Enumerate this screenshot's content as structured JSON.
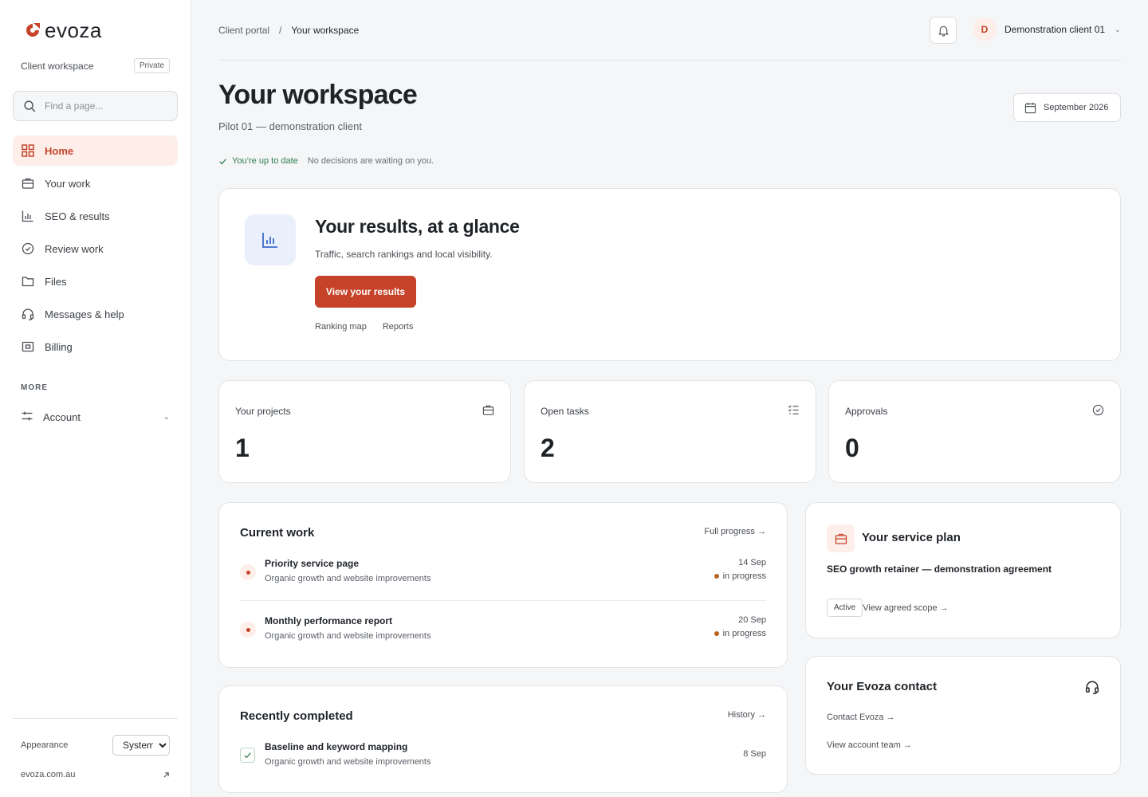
{
  "brand": {
    "name": "evoza",
    "accent": "#c6432a"
  },
  "sidebar": {
    "workspace_label": "Client workspace",
    "workspace_badge": "Private",
    "search_placeholder": "Find a page...",
    "nav": [
      {
        "label": "Home",
        "icon": "grid-icon",
        "active": true
      },
      {
        "label": "Your work",
        "icon": "briefcase-icon"
      },
      {
        "label": "SEO & results",
        "icon": "bar-chart-icon"
      },
      {
        "label": "Review work",
        "icon": "check-circle-icon"
      },
      {
        "label": "Files",
        "icon": "folder-icon"
      },
      {
        "label": "Messages & help",
        "icon": "headset-icon"
      },
      {
        "label": "Billing",
        "icon": "banknote-icon"
      }
    ],
    "more_label": "MORE",
    "account_label": "Account",
    "appearance_label": "Appearance",
    "appearance_value": "System",
    "appearance_options": [
      "System"
    ],
    "site_label": "evoza.com.au"
  },
  "header": {
    "breadcrumb_root": "Client portal",
    "breadcrumb_sep": "/",
    "breadcrumb_current": "Your workspace",
    "avatar_initial": "D",
    "user_name": "Demonstration client 01"
  },
  "page": {
    "title": "Your workspace",
    "subtitle": "Pilot 01 — demonstration client",
    "date_label": "September 2026",
    "status_ok": "You’re up to date",
    "status_msg": "No decisions are waiting on you."
  },
  "results": {
    "title": "Your results, at a glance",
    "subtitle": "Traffic, search rankings and local visibility.",
    "button": "View your results",
    "links": [
      "Ranking map",
      "Reports"
    ]
  },
  "stats": [
    {
      "label": "Your projects",
      "value": "1",
      "icon": "briefcase-icon"
    },
    {
      "label": "Open tasks",
      "value": "2",
      "icon": "checklist-icon"
    },
    {
      "label": "Approvals",
      "value": "0",
      "icon": "check-circle-icon"
    }
  ],
  "current_work": {
    "title": "Current work",
    "link": "Full progress →",
    "items": [
      {
        "title": "Priority service page",
        "desc": "Organic growth and website improvements",
        "date": "14 Sep",
        "status": "in progress"
      },
      {
        "title": "Monthly performance report",
        "desc": "Organic growth and website improvements",
        "date": "20 Sep",
        "status": "in progress"
      }
    ]
  },
  "recently_completed": {
    "title": "Recently completed",
    "link": "History →",
    "items": [
      {
        "title": "Baseline and keyword mapping",
        "desc": "Organic growth and website improvements",
        "date": "8 Sep"
      }
    ]
  },
  "service_plan": {
    "title": "Your service plan",
    "plan": "SEO growth retainer — demonstration agreement",
    "badge": "Active",
    "link": "View agreed scope →"
  },
  "contact": {
    "title": "Your Evoza contact",
    "link1": "Contact Evoza →",
    "link2": "View account team →"
  }
}
